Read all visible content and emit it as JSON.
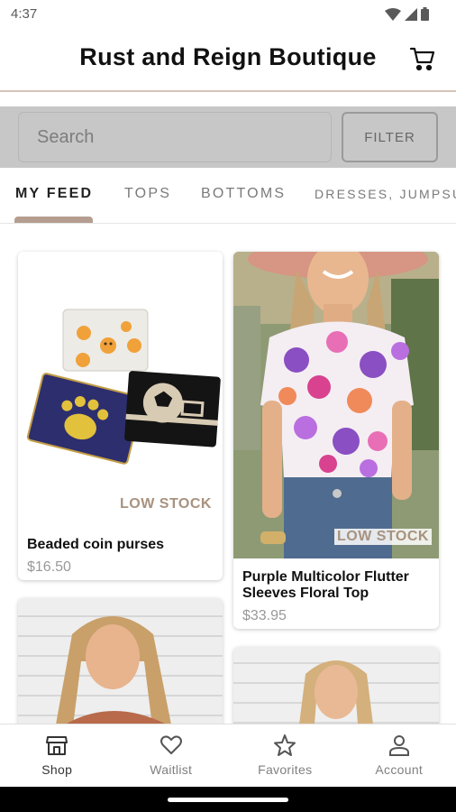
{
  "status_bar": {
    "time": "4:37"
  },
  "header": {
    "title": "Rust and Reign Boutique",
    "cart_icon": "cart-icon"
  },
  "search": {
    "placeholder": "Search",
    "filter_label": "FILTER"
  },
  "tabs": [
    {
      "label": "MY FEED",
      "active": true
    },
    {
      "label": "TOPS"
    },
    {
      "label": "BOTTOMS"
    },
    {
      "label": "DRESSES, JUMPSUI"
    }
  ],
  "products": [
    {
      "name": "Beaded coin purses",
      "price": "$16.50",
      "badge": "LOW STOCK"
    },
    {
      "name": "Purple Multicolor Flutter Sleeves Floral Top",
      "price": "$33.95",
      "badge": "LOW STOCK"
    },
    {
      "name": "",
      "price": ""
    },
    {
      "name": "",
      "price": ""
    }
  ],
  "bottom_nav": [
    {
      "label": "Shop",
      "icon": "shop-icon",
      "active": true
    },
    {
      "label": "Waitlist",
      "icon": "heart-icon"
    },
    {
      "label": "Favorites",
      "icon": "star-icon"
    },
    {
      "label": "Account",
      "icon": "account-icon"
    }
  ],
  "colors": {
    "accent": "#b59d8f",
    "badge": "#a8927f",
    "search_bg": "#c7c7c7"
  }
}
